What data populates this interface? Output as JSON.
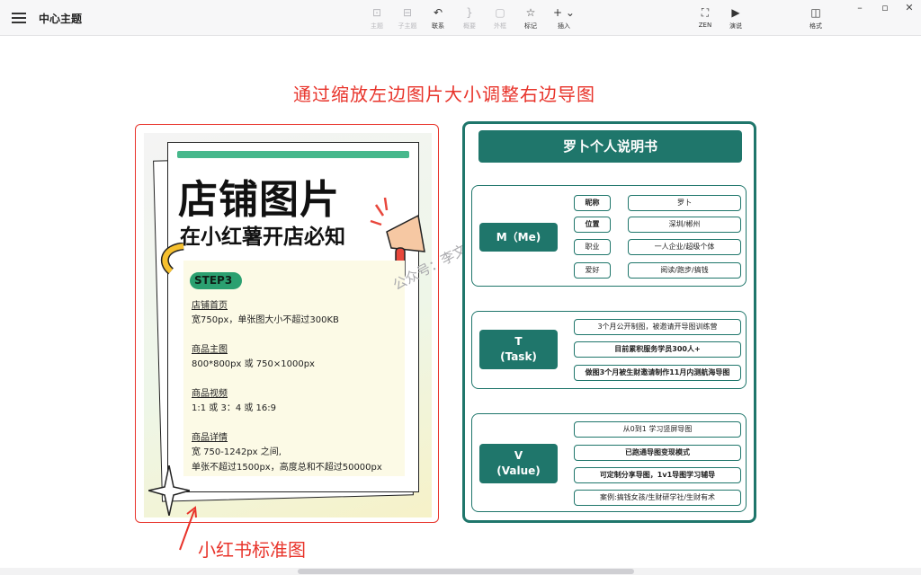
{
  "app": {
    "doc_title": "中心主题"
  },
  "toolbar": {
    "topic": "主题",
    "subtopic": "子主题",
    "relation": "联系",
    "summary": "概要",
    "boundary": "外框",
    "marker": "标记",
    "insert": "插入",
    "zen": "ZEN",
    "present": "演说",
    "format": "格式"
  },
  "canvas": {
    "headline": "通过缩放左边图片大小调整右边导图",
    "caption": "小红书标准图",
    "watermark": "公众号：李文懂"
  },
  "poster": {
    "title": "店铺图片",
    "subtitle": "在小红薯开店必知",
    "step": "STEP3",
    "sections": [
      {
        "heading": "店铺首页",
        "body": [
          "宽750px，单张图大小不超过300KB"
        ]
      },
      {
        "heading": "商品主图",
        "body": [
          "800*800px 或 750×1000px"
        ]
      },
      {
        "heading": "商品视频",
        "body": [
          "1:1 或 3：4 或 16:9"
        ]
      },
      {
        "heading": "商品详情",
        "body": [
          "宽 750-1242px 之间,",
          "单张不超过1500px，高度总和不超过50000px"
        ]
      }
    ]
  },
  "mindmap": {
    "title": "罗卜个人说明书",
    "groups": [
      {
        "root": "M（Me)",
        "leaves": [
          {
            "label": "昵称",
            "value": "罗卜"
          },
          {
            "label": "位置",
            "value": "深圳/郴州"
          },
          {
            "label": "职业",
            "value": "一人企业/超级个体"
          },
          {
            "label": "爱好",
            "value": "阅读/跑步/搞钱"
          }
        ]
      },
      {
        "root": "T\n(Task)",
        "items": [
          "3个月公开制图，被邀请开导图训练营",
          "目前累积服务学员300人+",
          "做图3个月被生财邀请制作11月内测航海导图"
        ]
      },
      {
        "root": "V\n(Value)",
        "items": [
          "从0到1 学习竖屏导图",
          "已跑通导图变现模式",
          "可定制分享导图，1v1导图学习辅导",
          "案例:搞钱女孩/生财研学社/生财有术"
        ]
      }
    ]
  },
  "colors": {
    "accent_red": "#e8332a",
    "teal": "#1f766b",
    "green": "#47b88c"
  }
}
